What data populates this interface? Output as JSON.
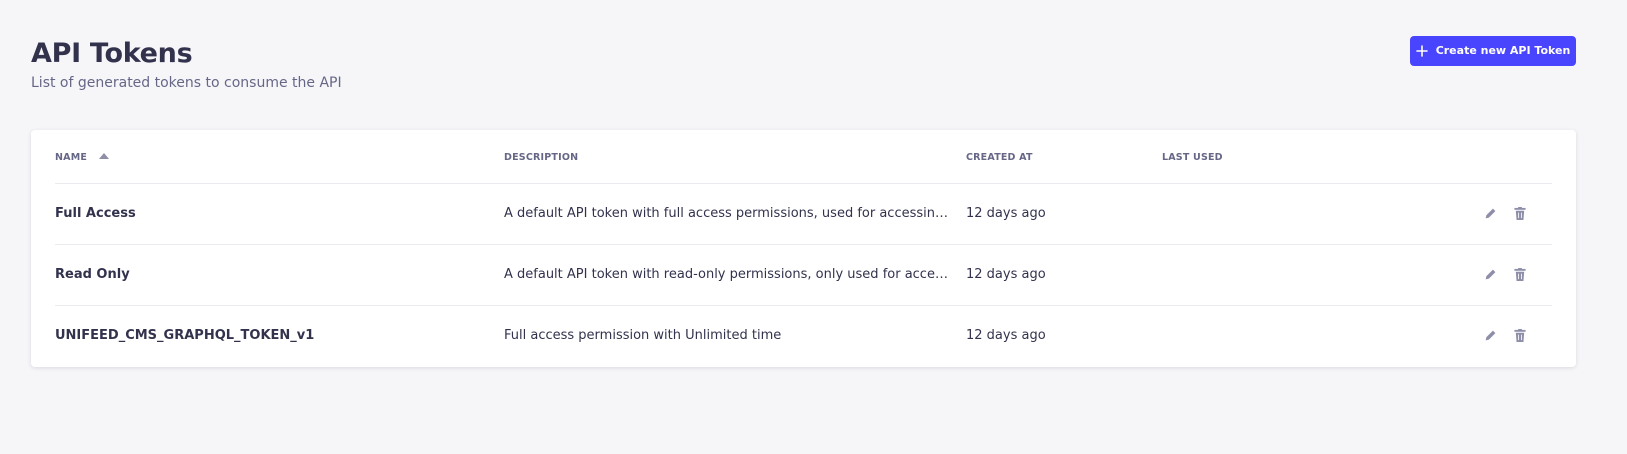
{
  "header": {
    "title": "API Tokens",
    "subtitle": "List of generated tokens to consume the API",
    "create_button_label": "Create new API Token",
    "create_button_icon": "plus-icon"
  },
  "colors": {
    "accent": "#4945ff",
    "background": "#f6f6f9",
    "card": "#ffffff",
    "text": "#32324d",
    "muted": "#666687",
    "icon": "#8e8ea9"
  },
  "table": {
    "columns": [
      {
        "label": "NAME",
        "sorted": "ascending",
        "sort_icon": "sort-up-icon"
      },
      {
        "label": "DESCRIPTION"
      },
      {
        "label": "CREATED AT"
      },
      {
        "label": "LAST USED"
      }
    ],
    "rows": [
      {
        "name": "Full Access",
        "description": "A default API token with full access permissions, used for accessing or modi...",
        "created_at": "12 days ago",
        "last_used": ""
      },
      {
        "name": "Read Only",
        "description": "A default API token with read-only permissions, only used for accessing res...",
        "created_at": "12 days ago",
        "last_used": ""
      },
      {
        "name": "UNIFEED_CMS_GRAPHQL_TOKEN_v1",
        "description": "Full access permission with Unlimited time",
        "created_at": "12 days ago",
        "last_used": ""
      }
    ],
    "row_actions": [
      "pencil-icon",
      "trash-icon"
    ]
  }
}
